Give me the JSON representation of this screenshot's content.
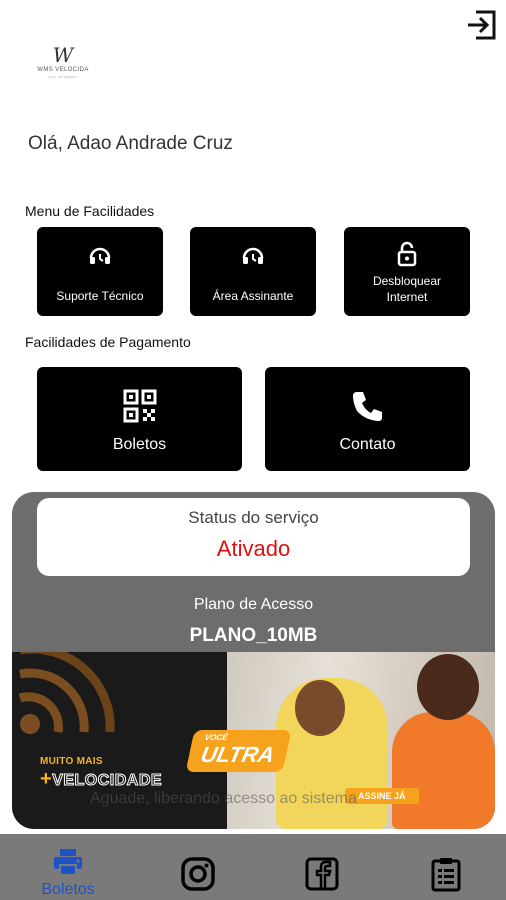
{
  "header": {
    "logout_icon": "logout-icon",
    "logo": {
      "mark": "W",
      "name": "WMS VELOCIDA",
      "tagline": "SUA INTERNET"
    }
  },
  "greeting": "Olá, Adao Andrade Cruz",
  "menu_facilidades": {
    "title": "Menu de Facilidades",
    "items": [
      {
        "label": "Suporte Técnico",
        "icon": "headset-icon"
      },
      {
        "label": "Área Assinante",
        "icon": "headset-icon"
      },
      {
        "label_line1": "Desbloquear",
        "label_line2": "Internet",
        "icon": "unlock-icon"
      }
    ]
  },
  "pagamento": {
    "title": "Facilidades de Pagamento",
    "items": [
      {
        "label": "Boletos",
        "icon": "qr-code-icon"
      },
      {
        "label": "Contato",
        "icon": "phone-icon"
      }
    ]
  },
  "status": {
    "title": "Status do serviço",
    "value": "Ativado",
    "value_color": "#e01010",
    "plan_title": "Plano de Acesso",
    "plan_value": "PLANO_10MB"
  },
  "banner": {
    "line1": "MUITO MAIS",
    "plus": "+",
    "line2": "VELOCIDADE",
    "ultra_small": "VOCÊ",
    "ultra": "ULTRA",
    "cta": "ASSINE JÁ",
    "overlay_text": "Aguade, liberando acesso ao sistema"
  },
  "bottom_nav": {
    "items": [
      {
        "label": "Boletos",
        "icon": "printer-icon"
      },
      {
        "icon": "instagram-icon"
      },
      {
        "icon": "facebook-icon"
      },
      {
        "icon": "clipboard-icon"
      }
    ],
    "active_color": "#1e53c7"
  }
}
